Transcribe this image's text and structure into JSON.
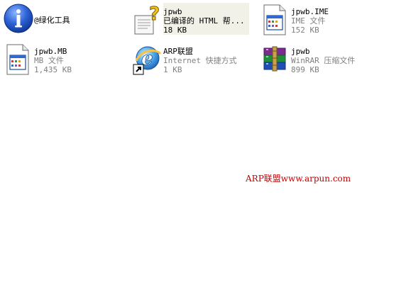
{
  "window": {
    "background": "#ffffff",
    "accent_text": "#000000",
    "secondary_text": "#808080",
    "watermark_color": "#c00000"
  },
  "items": [
    {
      "icon": "info-icon",
      "name": "@绿化工具"
    },
    {
      "icon": "help-file-icon",
      "name": "jpwb",
      "type": "已编译的 HTML 帮...",
      "size": "18 KB"
    },
    {
      "icon": "ime-file-icon",
      "name": "jpwb.IME",
      "type": "IME 文件",
      "size": "152 KB"
    },
    {
      "icon": "mb-file-icon",
      "name": "jpwb.MB",
      "type": "MB 文件",
      "size": "1,435 KB"
    },
    {
      "icon": "internet-shortcut-icon",
      "name": "ARP联盟",
      "type": "Internet 快捷方式",
      "size": "1 KB"
    },
    {
      "icon": "winrar-archive-icon",
      "name": "jpwb",
      "type": "WinRAR 压缩文件",
      "size": "899 KB"
    }
  ],
  "watermark": "ARP联盟www.arpun.com"
}
